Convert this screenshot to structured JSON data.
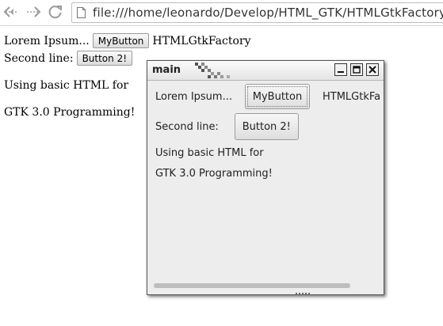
{
  "browser": {
    "address": "file:///home/leonardo/Develop/HTML_GTK/HTMLGtkFactory/s",
    "icons": {
      "back": "back-arrow-icon",
      "forward": "forward-arrow-icon",
      "reload": "reload-icon",
      "page": "page-icon"
    }
  },
  "page": {
    "line1_text": "Lorem Ipsum...",
    "line1_button": "MyButton",
    "line1_after": "HTMLGtkFactory",
    "line2_text": "Second line:",
    "line2_button": "Button 2!",
    "para1": "Using basic HTML for",
    "para2": "GTK 3.0 Programming!"
  },
  "gtk_window": {
    "title": "main",
    "line1_text": "Lorem Ipsum...",
    "line1_button": "MyButton",
    "line1_after": "HTMLGtkFa",
    "line2_text": "Second line:",
    "line2_button": "Button 2!",
    "para1": "Using basic HTML for",
    "para2": "GTK 3.0 Programming!",
    "controls": [
      "minimize-icon",
      "maximize-icon",
      "close-icon"
    ]
  },
  "colors": {
    "window_bg": "#ededed",
    "page_bg": "#ffffff"
  }
}
